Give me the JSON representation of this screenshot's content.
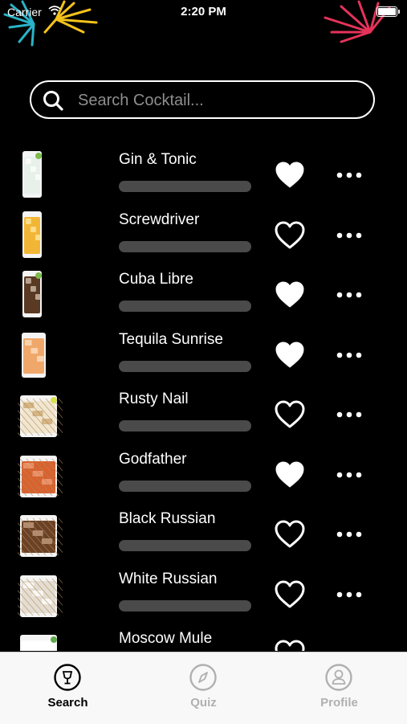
{
  "status_bar": {
    "carrier": "Carrier",
    "time": "2:20 PM"
  },
  "search": {
    "placeholder": "Search Cocktail...",
    "value": "",
    "icon": "search-icon"
  },
  "cocktails": [
    {
      "name": "Gin & Tonic",
      "favorite": true,
      "glass": "highball",
      "liquid": "#e8f0ea",
      "garnish": "lime",
      "ice": "#ffffff"
    },
    {
      "name": "Screwdriver",
      "favorite": false,
      "glass": "highball",
      "liquid": "#f2b636",
      "garnish": "none",
      "ice": "#ffe9a6"
    },
    {
      "name": "Cuba Libre",
      "favorite": true,
      "glass": "highball",
      "liquid": "#5a3a22",
      "garnish": "lime",
      "ice": "#d9c7b5"
    },
    {
      "name": "Tequila Sunrise",
      "favorite": true,
      "glass": "tall",
      "liquid": "#f0a86a",
      "garnish": "none",
      "ice": "#fde2c8"
    },
    {
      "name": "Rusty Nail",
      "favorite": false,
      "glass": "rocks",
      "liquid": "#f1e6cf",
      "garnish": "lemon",
      "ice": "#c9a46a"
    },
    {
      "name": "Godfather",
      "favorite": true,
      "glass": "rocks",
      "liquid": "#d9622f",
      "garnish": "none",
      "ice": "#f4a27d"
    },
    {
      "name": "Black Russian",
      "favorite": false,
      "glass": "rocks",
      "liquid": "#6b4226",
      "garnish": "none",
      "ice": "#caa68a"
    },
    {
      "name": "White Russian",
      "favorite": false,
      "glass": "rocks",
      "liquid": "#e4ddd2",
      "garnish": "none",
      "ice": "#ffffff"
    },
    {
      "name": "Moscow Mule",
      "favorite": false,
      "glass": "mug",
      "liquid": "#ffffff",
      "garnish": "mint",
      "ice": "#ffffff"
    }
  ],
  "tabs": [
    {
      "label": "Search",
      "icon": "cocktail-glass-icon",
      "active": true
    },
    {
      "label": "Quiz",
      "icon": "compass-icon",
      "active": false
    },
    {
      "label": "Profile",
      "icon": "person-icon",
      "active": false
    }
  ],
  "colors": {
    "background": "#000000",
    "active_tab": "#000000",
    "inactive_tab": "#b0b0b0",
    "bar_track": "#4a4a4a",
    "tab_bar_bg": "#f8f8f8"
  }
}
